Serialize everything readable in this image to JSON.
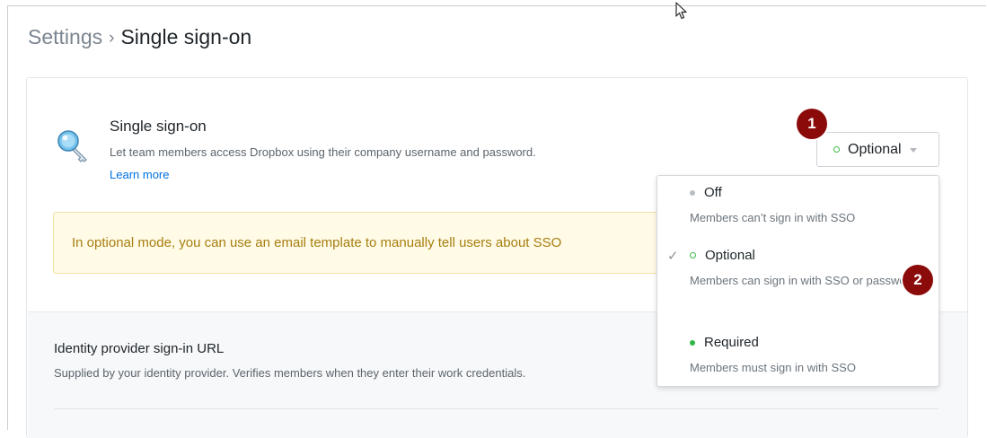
{
  "breadcrumb": {
    "root": "Settings",
    "separator": "›",
    "current": "Single sign-on"
  },
  "sso": {
    "title": "Single sign-on",
    "description": "Let team members access Dropbox using their company username and password.",
    "learn_more": "Learn more",
    "selected_value": "Optional"
  },
  "notice": {
    "text": "In optional mode, you can use an email template to manually tell users about SSO"
  },
  "identity_provider": {
    "title": "Identity provider sign-in URL",
    "description": "Supplied by your identity provider. Verifies members when they enter their work credentials."
  },
  "dropdown": {
    "options": [
      {
        "label": "Off",
        "description": "Members can’t sign in with SSO",
        "selected": false
      },
      {
        "label": "Optional",
        "description": "Members can sign in with SSO or password",
        "selected": true
      },
      {
        "label": "Required",
        "description": "Members must sign in with SSO",
        "selected": false
      }
    ],
    "check_glyph": "✓"
  },
  "badges": {
    "first": "1",
    "second": "2"
  },
  "colors": {
    "link": "#0070e0",
    "status_green": "#2fb745",
    "status_grey": "#b9bec3",
    "badge": "#8b0a0a",
    "notice_bg": "#fffbe6",
    "notice_text": "#a77d10"
  },
  "icons": {
    "sso": "key-icon",
    "dropdown": "caret-down-icon",
    "pointer": "mouse-cursor-icon"
  }
}
